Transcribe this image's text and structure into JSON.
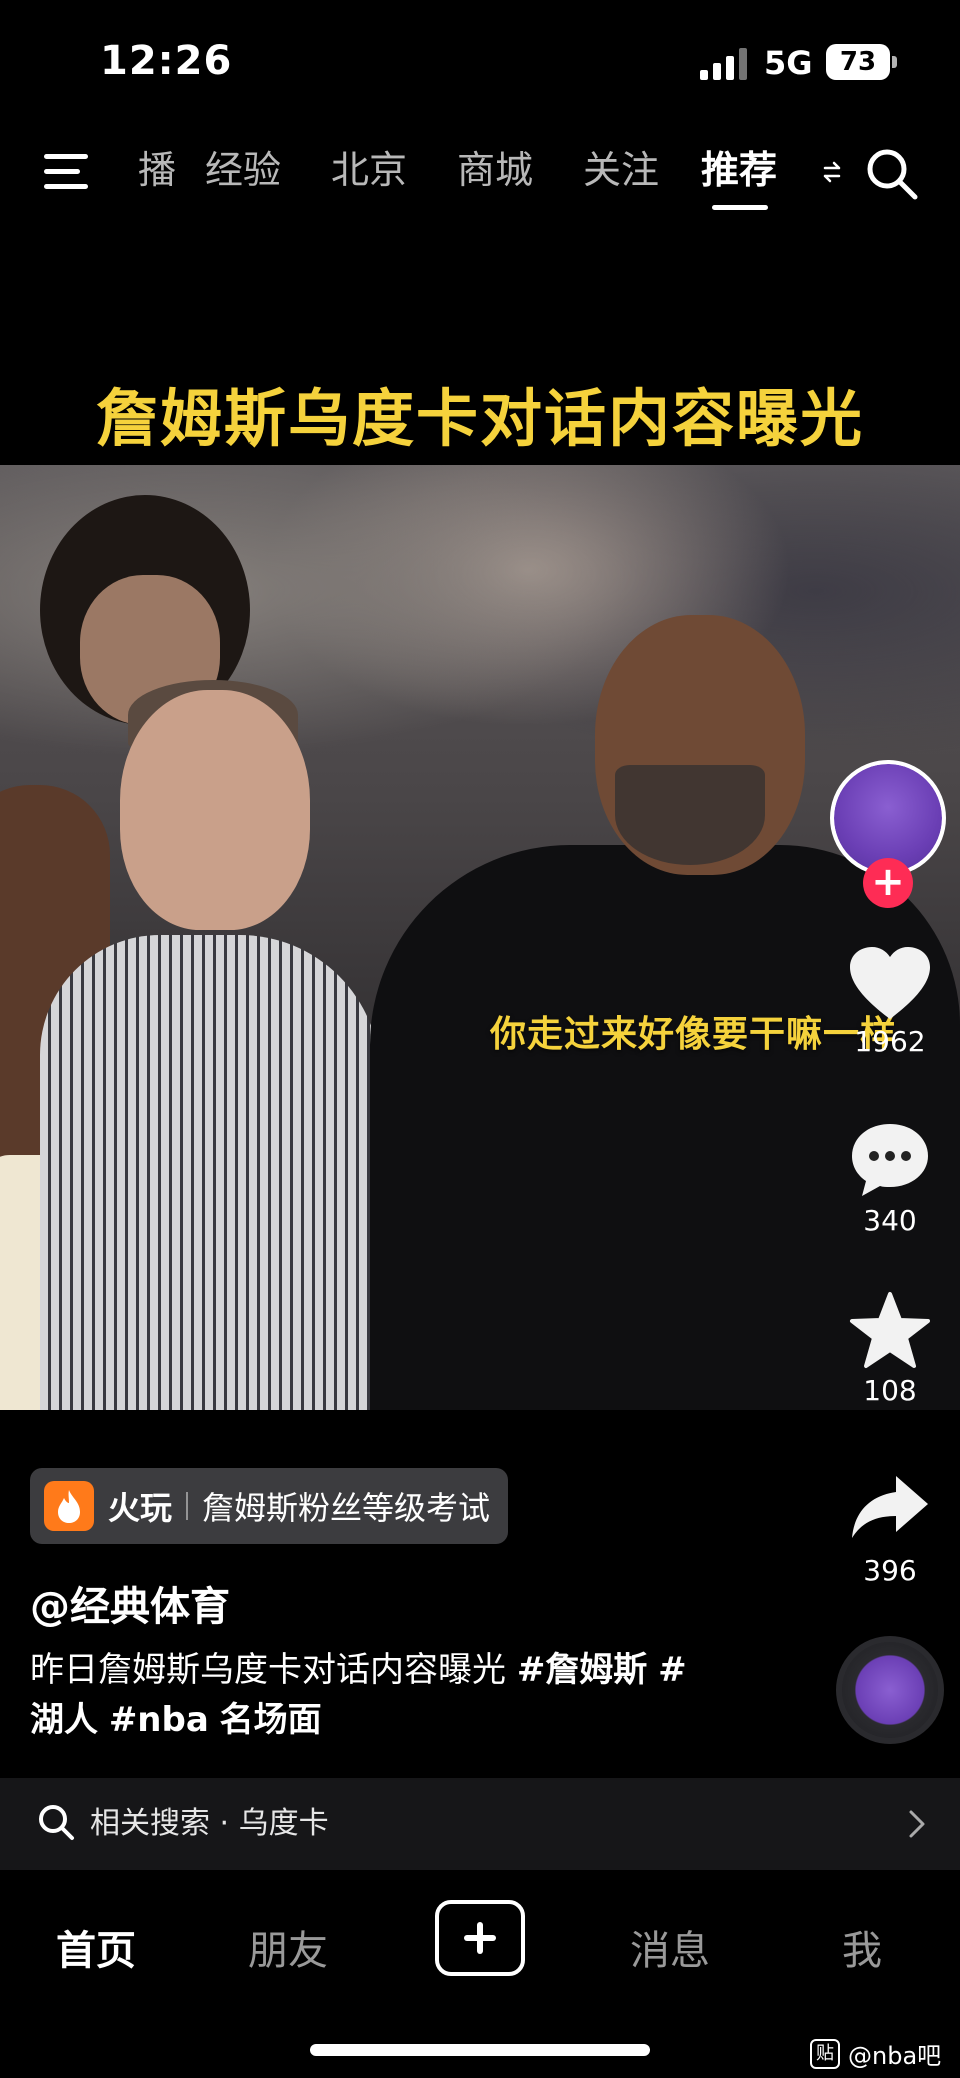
{
  "status_bar": {
    "time": "12:26",
    "network": "5G",
    "battery": "73"
  },
  "top_nav": {
    "tabs": [
      "播",
      "经验",
      "北京",
      "商城",
      "关注",
      "推荐"
    ],
    "active_tab": "推荐"
  },
  "video": {
    "title": "詹姆斯乌度卡对话内容曝光",
    "caption": "你走过来好像要干嘛一样"
  },
  "actions": {
    "likes": "1962",
    "comments": "340",
    "favorites": "108",
    "shares": "396"
  },
  "promo": {
    "brand": "火玩",
    "text": "詹姆斯粉丝等级考试"
  },
  "post": {
    "author": "@经典体育",
    "description": "昨日詹姆斯乌度卡对话内容曝光 ",
    "tags": [
      "#詹姆斯",
      "#",
      "湖人",
      "#nba",
      "名场面"
    ]
  },
  "related_search": {
    "label": "相关搜索",
    "separator": "·",
    "query": "乌度卡"
  },
  "bottom_tabs": {
    "home": "首页",
    "friends": "朋友",
    "messages": "消息",
    "me": "我"
  },
  "watermark": {
    "badge": "贴",
    "text": "@nba吧"
  },
  "colors": {
    "accent_red": "#fe2c55",
    "caption_yellow": "#f5d23c",
    "promo_orange": "#ff7a1a"
  }
}
